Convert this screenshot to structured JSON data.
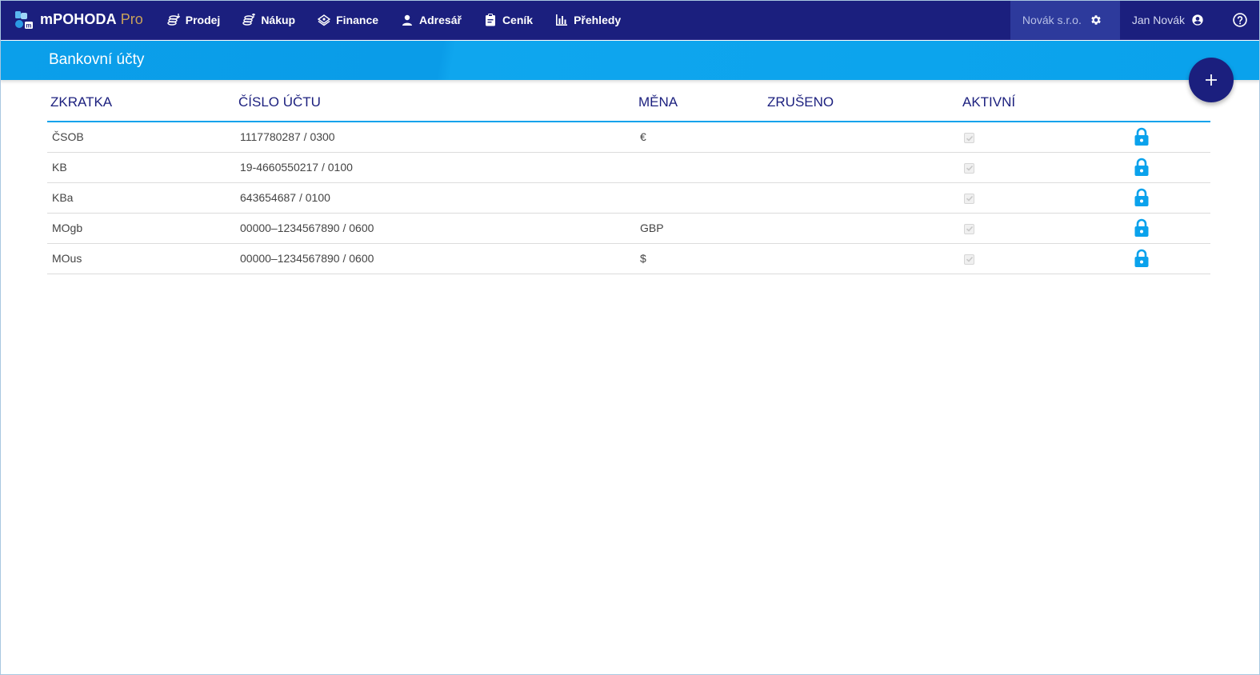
{
  "app": {
    "name": "mPOHODA",
    "edition": "Pro"
  },
  "nav": [
    {
      "label": "Prodej",
      "icon": "coins-down-icon"
    },
    {
      "label": "Nákup",
      "icon": "coins-up-icon"
    },
    {
      "label": "Finance",
      "icon": "money-stack-icon"
    },
    {
      "label": "Adresář",
      "icon": "person-icon"
    },
    {
      "label": "Ceník",
      "icon": "clipboard-icon"
    },
    {
      "label": "Přehledy",
      "icon": "bar-chart-icon"
    }
  ],
  "header_right": {
    "company": "Novák s.r.o.",
    "user": "Jan Novák"
  },
  "page": {
    "title": "Bankovní účty"
  },
  "table": {
    "columns": [
      "ZKRATKA",
      "ČÍSLO ÚČTU",
      "MĚNA",
      "ZRUŠENO",
      "AKTIVNÍ"
    ],
    "rows": [
      {
        "abbr": "ČSOB",
        "account": "1117780287 / 0300",
        "currency": "€",
        "cancelled": "",
        "active": true
      },
      {
        "abbr": "KB",
        "account": "19-4660550217 / 0100",
        "currency": "",
        "cancelled": "",
        "active": true
      },
      {
        "abbr": "KBa",
        "account": "643654687 / 0100",
        "currency": "",
        "cancelled": "",
        "active": true
      },
      {
        "abbr": "MOgb",
        "account": "00000–1234567890 / 0600",
        "currency": "GBP",
        "cancelled": "",
        "active": true
      },
      {
        "abbr": "MOus",
        "account": "00000–1234567890 / 0600",
        "currency": "$",
        "cancelled": "",
        "active": true
      }
    ]
  },
  "colors": {
    "topbar": "#1b1f7e",
    "accent": "#0aa2ec",
    "link": "#1aa3e8",
    "lock": "#0aa2ec"
  }
}
